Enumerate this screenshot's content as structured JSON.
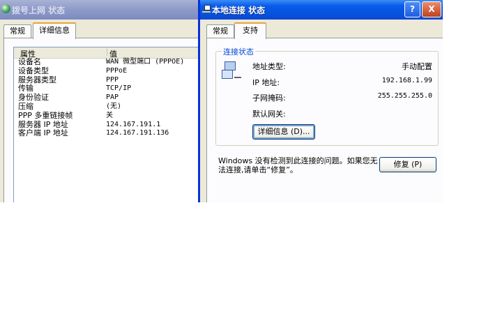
{
  "dialup_window": {
    "title": "拨号上网 状态",
    "tabs": [
      {
        "label": "常规"
      },
      {
        "label": "详细信息"
      }
    ],
    "details": {
      "columns": [
        "属性",
        "值"
      ],
      "rows": [
        {
          "property": "设备名",
          "value": "WAN 微型端口 (PPPOE)"
        },
        {
          "property": "设备类型",
          "value": "PPPoE"
        },
        {
          "property": "服务器类型",
          "value": "PPP"
        },
        {
          "property": "传输",
          "value": "TCP/IP"
        },
        {
          "property": "身份验证",
          "value": "PAP"
        },
        {
          "property": "压缩",
          "value": "(无)"
        },
        {
          "property": "PPP 多重链接帧",
          "value": "关"
        },
        {
          "property": "服务器 IP 地址",
          "value": "124.167.191.1"
        },
        {
          "property": "客户端 IP 地址",
          "value": "124.167.191.136"
        }
      ]
    }
  },
  "lan_window": {
    "title": "本地连接 状态",
    "help_button": "?",
    "close_button": "X",
    "tabs": [
      {
        "label": "常规"
      },
      {
        "label": "支持"
      }
    ],
    "connection_status": {
      "group_title": "连接状态",
      "address_type_label": "地址类型:",
      "address_type_value": "手动配置",
      "ip_label": "IP 地址:",
      "ip_value": "192.168.1.99",
      "subnet_label": "子网掩码:",
      "subnet_value": "255.255.255.0",
      "gateway_label": "默认网关:",
      "gateway_value": "",
      "details_button": "详细信息 (D)..."
    },
    "problem_text": "Windows 没有检测到此连接的问题。如果您无法连接,请单击“修复”。",
    "repair_button": "修复 (P)"
  }
}
